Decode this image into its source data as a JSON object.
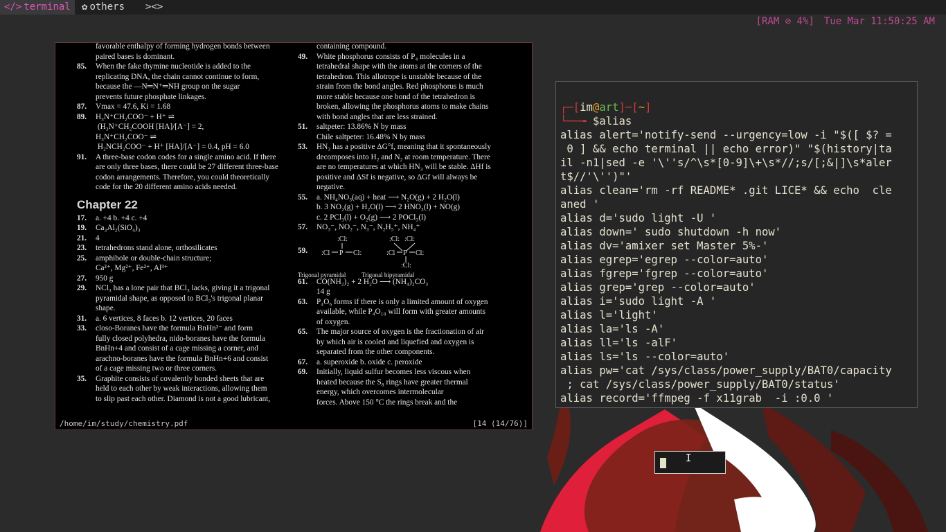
{
  "topbar": {
    "workspaces": [
      {
        "icon": "</>",
        "label": "terminal",
        "active": true
      },
      {
        "icon": "✿",
        "label": "others",
        "active": false
      },
      {
        "icon": "",
        "label": "><>",
        "active": false
      }
    ],
    "ram": "[RAM ⊘ 4%]",
    "clock": "Tue Mar 11:50:25 AM",
    "colors": {
      "accent": "#d958b4",
      "status": "#c04a93",
      "bar_bg": "#1f1f1f"
    }
  },
  "pdf": {
    "path": "/home/im/study/chemistry.pdf",
    "page": "[14 (14/76)]",
    "left_column": [
      {
        "n": "",
        "t": "favorable enthalpy of forming hydrogen bonds between"
      },
      {
        "n": "",
        "t": "paired bases is dominant."
      },
      {
        "n": "85.",
        "t": "When the fake thymine nucleotide is added to the"
      },
      {
        "n": "",
        "t": "replicating DNA, the chain cannot continue to form,"
      },
      {
        "n": "",
        "t": "because the —N═N⁺═NH group on the sugar"
      },
      {
        "n": "",
        "t": "prevents future phosphate linkages."
      },
      {
        "n": "87.",
        "t": "Vmax = 47.6, Ki = 1.68"
      },
      {
        "n": "89.",
        "t": "H₃N⁺CH₂COO⁻ + H⁺ ⇌"
      },
      {
        "n": "",
        "t": "            (H₃N⁺CH₂COOH [HA]/[A⁻] = 2,"
      },
      {
        "n": "",
        "t": "H₃N⁺CH₂COO⁻ ⇌"
      },
      {
        "n": "",
        "t": "      H₂NCH₂COO⁻ + H⁺ [HA]/[A⁻] = 0.4, pH = 6.0"
      },
      {
        "n": "91.",
        "t": "A three-base codon codes for a single amino acid. If there"
      },
      {
        "n": "",
        "t": "are only three bases, there could be 27 different three-base"
      },
      {
        "n": "",
        "t": "codon arrangements. Therefore, you could theoretically"
      },
      {
        "n": "",
        "t": "code for the 20 different amino acids needed."
      }
    ],
    "chapter": "Chapter 22",
    "left_column2": [
      {
        "n": "17.",
        "t": "a.  +4                  b.  +4               c.  +4"
      },
      {
        "n": "19.",
        "t": "Ca₃Al₂(SiO₄)₃"
      },
      {
        "n": "21.",
        "t": "4"
      },
      {
        "n": "23.",
        "t": "tetrahedrons stand alone, orthosilicates"
      },
      {
        "n": "25.",
        "t": "amphibole or double-chain structure;"
      },
      {
        "n": "",
        "t": "Ca²⁺, Mg²⁺, Fe²⁺, Al³⁺"
      },
      {
        "n": "27.",
        "t": "950 g"
      },
      {
        "n": "29.",
        "t": "NCl₃ has a lone pair that BCl₃ lacks, giving it a trigonal"
      },
      {
        "n": "",
        "t": "pyramidal shape, as opposed to BCl₃'s trigonal planar"
      },
      {
        "n": "",
        "t": "shape."
      },
      {
        "n": "31.",
        "t": "a.  6 vertices, 8 faces          b.  12 vertices, 20 faces"
      },
      {
        "n": "33.",
        "t": "closo-Boranes have the formula BnHn²⁻ and form"
      },
      {
        "n": "",
        "t": "fully closed polyhedra, nido-boranes have the formula"
      },
      {
        "n": "",
        "t": "BnHn+4 and consist of a cage missing a corner, and"
      },
      {
        "n": "",
        "t": "arachno-boranes have the formula BnHn+6 and consist"
      },
      {
        "n": "",
        "t": "of a cage missing two or three corners."
      },
      {
        "n": "35.",
        "t": "Graphite consists of covalently bonded sheets that are"
      },
      {
        "n": "",
        "t": "held to each other by weak interactions, allowing them"
      },
      {
        "n": "",
        "t": "to slip past each other. Diamond is not a good lubricant,"
      }
    ],
    "right_column": [
      {
        "n": "",
        "t": "containing compound."
      },
      {
        "n": "49.",
        "t": "White phosphorus consists of P₄ molecules in a"
      },
      {
        "n": "",
        "t": "tetrahedral shape with the atoms at the corners of the"
      },
      {
        "n": "",
        "t": "tetrahedron. This allotrope is unstable because of the"
      },
      {
        "n": "",
        "t": "strain from the bond angles. Red phosphorus is much"
      },
      {
        "n": "",
        "t": "more stable because one bond of the tetrahedron is"
      },
      {
        "n": "",
        "t": "broken, allowing the phosphorus atoms to make chains"
      },
      {
        "n": "",
        "t": "with bond angles that are less strained."
      },
      {
        "n": "51.",
        "t": "saltpeter: 13.86% N by mass"
      },
      {
        "n": "",
        "t": "Chile saltpeter: 16.48% N by mass"
      },
      {
        "n": "53.",
        "t": "HN₃ has a positive ΔG°f, meaning that it spontaneously"
      },
      {
        "n": "",
        "t": "decomposes into H₂ and N₂ at room temperature. There"
      },
      {
        "n": "",
        "t": "are no temperatures at which HN₃ will be stable. ΔHf is"
      },
      {
        "n": "",
        "t": "positive and ΔSf is negative, so ΔGf will always be"
      },
      {
        "n": "",
        "t": "negative."
      },
      {
        "n": "55.",
        "t": "a.  NH₄NO₃(aq) + heat ⟶ N₂O(g) + 2 H₂O(l)"
      },
      {
        "n": "",
        "t": "b.  3 NO₂(g) + H₂O(l) ⟶ 2 HNO₃(l) + NO(g)"
      },
      {
        "n": "",
        "t": "c.  2 PCl₃(l) + O₂(g) ⟶ 2 POCl₃(l)"
      },
      {
        "n": "57.",
        "t": "NO₃⁻, NO₂⁻, N₃⁻, N₂H₅⁺, NH₄⁺"
      }
    ],
    "structure_labels": [
      "Trigonal pyramidal",
      "Trigonal bipyramidal"
    ],
    "right_column2": [
      {
        "n": "61.",
        "t": "CO(NH₂)₂ + 2 H₂O ⟶ (NH₄)₂CO₃"
      },
      {
        "n": "",
        "t": "14 g"
      },
      {
        "n": "63.",
        "t": "P₄O₆ forms if there is only a limited amount of oxygen"
      },
      {
        "n": "",
        "t": "available, while P₄O₁₀ will form with greater amounts"
      },
      {
        "n": "",
        "t": "of oxygen."
      },
      {
        "n": "65.",
        "t": "The major source of oxygen is the fractionation of air"
      },
      {
        "n": "",
        "t": "by which air is cooled and liquefied and oxygen is"
      },
      {
        "n": "",
        "t": "separated from the other components."
      },
      {
        "n": "67.",
        "t": "a.  superoxide          b.  oxide          c.  peroxide"
      },
      {
        "n": "69.",
        "t": "Initially, liquid sulfur becomes less viscous when"
      },
      {
        "n": "",
        "t": "heated because the S₈ rings have greater thermal"
      },
      {
        "n": "",
        "t": "energy, which overcomes intermolecular"
      },
      {
        "n": "",
        "t": "forces. Above 150 °C the rings break and the"
      }
    ]
  },
  "terminal": {
    "prompt": {
      "user": "im",
      "host": "art",
      "dir": "~",
      "command": "$alias"
    },
    "lines": [
      "alias alert='notify-send --urgency=low -i \"$([ $? =",
      " 0 ] && echo terminal || echo error)\" \"$(history|ta",
      "il -n1|sed -e '\\''s/^\\s*[0-9]\\+\\s*//;s/[;&|]\\s*aler",
      "t$//'\\'')\"'",
      "alias clean='rm -rf README* .git LICE* && echo  cle",
      "aned '",
      "alias d='sudo light -U '",
      "alias down=' sudo shutdown -h now'",
      "alias dv='amixer set Master 5%-'",
      "alias egrep='egrep --color=auto'",
      "alias fgrep='fgrep --color=auto'",
      "alias grep='grep --color=auto'",
      "alias i='sudo light -A '",
      "alias l='light'",
      "alias la='ls -A'",
      "alias ll='ls -alF'",
      "alias ls='ls --color=auto'",
      "alias pw='cat /sys/class/power_supply/BAT0/capacity",
      " ; cat /sys/class/power_supply/BAT0/status'",
      "alias record='ffmpeg -f x11grab  -i :0.0 '"
    ]
  }
}
